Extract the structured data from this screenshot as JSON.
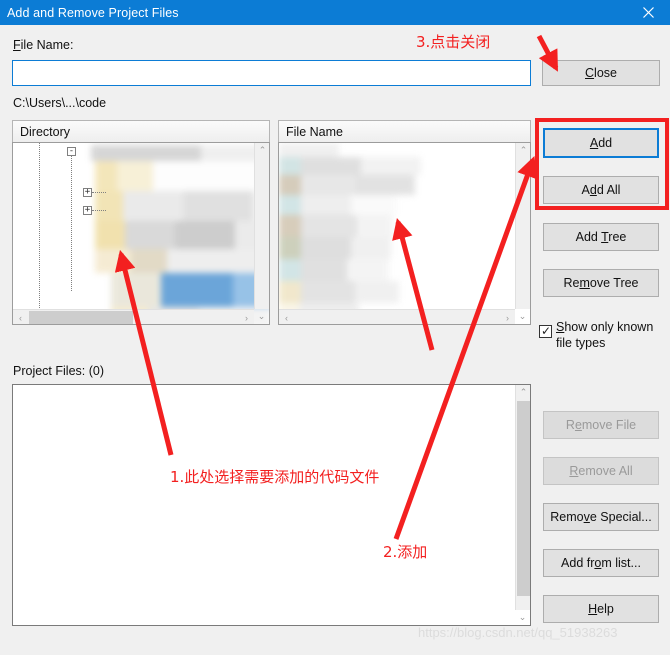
{
  "window": {
    "title": "Add and Remove Project Files",
    "close_icon": "close-x-icon",
    "titlebar_color": "#0c7cd5"
  },
  "form": {
    "file_name_label": "File Name:",
    "file_name_label_accel": "F",
    "file_name_value": "",
    "file_name_placeholder": "",
    "current_path": "C:\\Users\\...\\code",
    "project_files_label": "Project Files: (0)"
  },
  "panels": {
    "directory": {
      "header": "Directory"
    },
    "file_name": {
      "header": "File Name"
    }
  },
  "buttons": {
    "close": {
      "label": "Close",
      "accel": "C",
      "state": "enabled"
    },
    "add": {
      "label": "Add",
      "accel": "A",
      "state": "focused"
    },
    "add_all": {
      "label": "Add All",
      "accel": "d",
      "state": "enabled"
    },
    "add_tree": {
      "label": "Add Tree",
      "accel": "T",
      "state": "enabled"
    },
    "remove_tree": {
      "label": "Remove Tree",
      "accel": "m",
      "state": "enabled"
    },
    "remove_file": {
      "label": "Remove File",
      "accel": "e",
      "state": "disabled"
    },
    "remove_all": {
      "label": "Remove All",
      "accel": "R",
      "state": "disabled"
    },
    "remove_special": {
      "label": "Remove Special...",
      "accel": "v",
      "state": "enabled"
    },
    "add_from_list": {
      "label": "Add from list...",
      "accel": "o",
      "state": "enabled"
    },
    "help": {
      "label": "Help",
      "accel": "H",
      "state": "enabled"
    }
  },
  "checkbox": {
    "label_line1": "Show only known",
    "label_line2": "file types",
    "accel": "S",
    "checked": true,
    "check_glyph": "✓"
  },
  "scrollbars": {
    "up_glyph": "⌃",
    "down_glyph": "⌄",
    "left_glyph": "‹",
    "right_glyph": "›"
  },
  "tree": {
    "collapse_glyph": "-",
    "expand_glyph": "+",
    "redacted": true
  },
  "annotations": {
    "color": "#f32020",
    "items": [
      {
        "id": "anno-1",
        "text": "1.此处选择需要添加的代码文件"
      },
      {
        "id": "anno-2",
        "text": "2.添加"
      },
      {
        "id": "anno-3",
        "text": "3.点击关闭"
      }
    ]
  },
  "watermark": {
    "text": "https://blog.csdn.net/qq_51938263"
  }
}
